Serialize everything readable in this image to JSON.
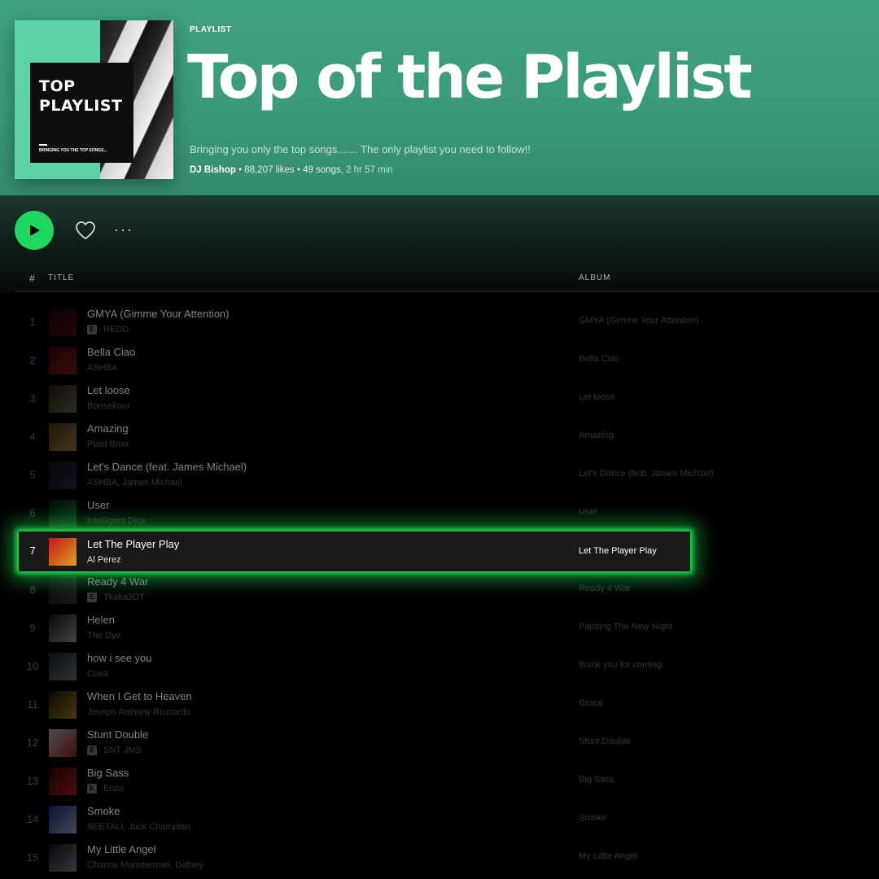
{
  "playlist": {
    "type_label": "PLAYLIST",
    "title": "Top of the Playlist",
    "description": "Bringing you only the top songs....... The only playlist you need to follow!!",
    "owner": "DJ Bishop",
    "likes": "88,207 likes",
    "songs": "49 songs,",
    "duration": "2 hr 57 min",
    "separator": " • ",
    "cover": {
      "line1": "TOP",
      "line2": "PLAYLIST",
      "tagline": "BRINGING YOU THE TOP SONGS..."
    }
  },
  "actions": {
    "play_icon": "play-icon",
    "heart_icon": "heart-icon",
    "more_label": "···"
  },
  "columns": {
    "number": "#",
    "title": "TITLE",
    "album": "ALBUM"
  },
  "colors": {
    "accent": "#1ed760",
    "header_green": "#3fa282",
    "highlight_glow": "#22e455"
  },
  "tracks": [
    {
      "num": "1",
      "title": "GMYA (Gimme Your Attention)",
      "artist": "REDD",
      "explicit": true,
      "album": "GMYA (Gimme Your Attention)",
      "art": [
        "#1a0508",
        "#6a1018"
      ]
    },
    {
      "num": "2",
      "title": "Bella Ciao",
      "artist": "ASHBA",
      "explicit": false,
      "album": "Bella Ciao",
      "art": [
        "#3a0a0a",
        "#b02020"
      ]
    },
    {
      "num": "3",
      "title": "Let loose",
      "artist": "Bonsekour",
      "explicit": false,
      "album": "Let loose",
      "art": [
        "#2a2218",
        "#8a7a5a"
      ]
    },
    {
      "num": "4",
      "title": "Amazing",
      "artist": "Plaid Brixx",
      "explicit": false,
      "album": "Amazing",
      "art": [
        "#5a3a20",
        "#d09a50"
      ]
    },
    {
      "num": "5",
      "title": "Let's Dance (feat. James Michael)",
      "artist": "ASHBA, James Michael",
      "explicit": false,
      "album": "Let's Dance (feat. James Michael)",
      "art": [
        "#101018",
        "#403060"
      ]
    },
    {
      "num": "6",
      "title": "User",
      "artist": "Intelligent Dice",
      "explicit": false,
      "album": "User",
      "art": [
        "#0a2010",
        "#20a040"
      ]
    },
    {
      "num": "7",
      "title": "Let The Player Play",
      "artist": "Al Perez",
      "explicit": false,
      "album": "Let The Player Play",
      "art": [
        "#c01818",
        "#e0a020"
      ],
      "active": true
    },
    {
      "num": "8",
      "title": "Ready 4 War",
      "artist": "Tkaka3DT",
      "explicit": true,
      "album": "Ready 4 War",
      "art": [
        "#101010",
        "#505050"
      ]
    },
    {
      "num": "9",
      "title": "Helen",
      "artist": "The Dye",
      "explicit": false,
      "album": "Painting The New Night",
      "art": [
        "#181818",
        "#c0c0c0"
      ]
    },
    {
      "num": "10",
      "title": "how i see you",
      "artist": "Cova",
      "explicit": false,
      "album": "thank you for coming.",
      "art": [
        "#202830",
        "#8090a0"
      ]
    },
    {
      "num": "11",
      "title": "When I Get to Heaven",
      "artist": "Joseph Anthony Ricciardo",
      "explicit": false,
      "album": "Grace",
      "art": [
        "#201808",
        "#d0a030"
      ]
    },
    {
      "num": "12",
      "title": "Stunt Double",
      "artist": "SNT JMS",
      "explicit": true,
      "album": "Stunt Double",
      "art": [
        "#e0e0e0",
        "#c02020"
      ]
    },
    {
      "num": "13",
      "title": "Big Sass",
      "artist": "Enzo",
      "explicit": true,
      "album": "Big Sass",
      "art": [
        "#3a0808",
        "#e02020"
      ]
    },
    {
      "num": "14",
      "title": "Smoke",
      "artist": "SEETALI, Jack Champion",
      "explicit": false,
      "album": "Smoke",
      "art": [
        "#2030a0",
        "#c0d0f0"
      ]
    },
    {
      "num": "15",
      "title": "My Little Angel",
      "artist": "Chance Munsterman, Dafney",
      "explicit": false,
      "album": "My Little Angel",
      "art": [
        "#101018",
        "#a0a0c0"
      ]
    }
  ]
}
